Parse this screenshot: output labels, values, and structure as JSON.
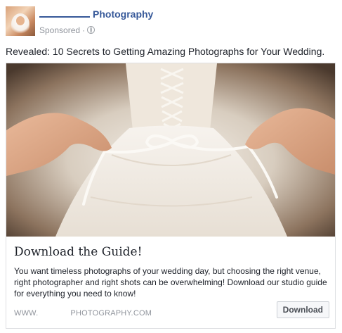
{
  "post": {
    "page_name": "Photography",
    "sponsored_label": "Sponsored",
    "separator": "·",
    "privacy_icon": "globe-icon",
    "text": "Revealed: 10 Secrets to Getting Amazing Photographs for Your Wedding."
  },
  "attachment": {
    "image_icon": "wedding-dress-lacing-photo",
    "headline": "Download the Guide!",
    "description": "You want timeless photographs of your wedding day, but choosing the right venue, right photographer and right shots can be overwhelming! Download our studio guide for everything you need to know!",
    "domain_prefix": "WWW.",
    "domain_suffix": "PHOTOGRAPHY.COM",
    "button_label": "Download"
  },
  "colors": {
    "page_name": "#365899",
    "meta_text": "#90949c",
    "body_text": "#1d2129",
    "border": "#dddfe2",
    "button_bg": "#f6f7f9"
  }
}
